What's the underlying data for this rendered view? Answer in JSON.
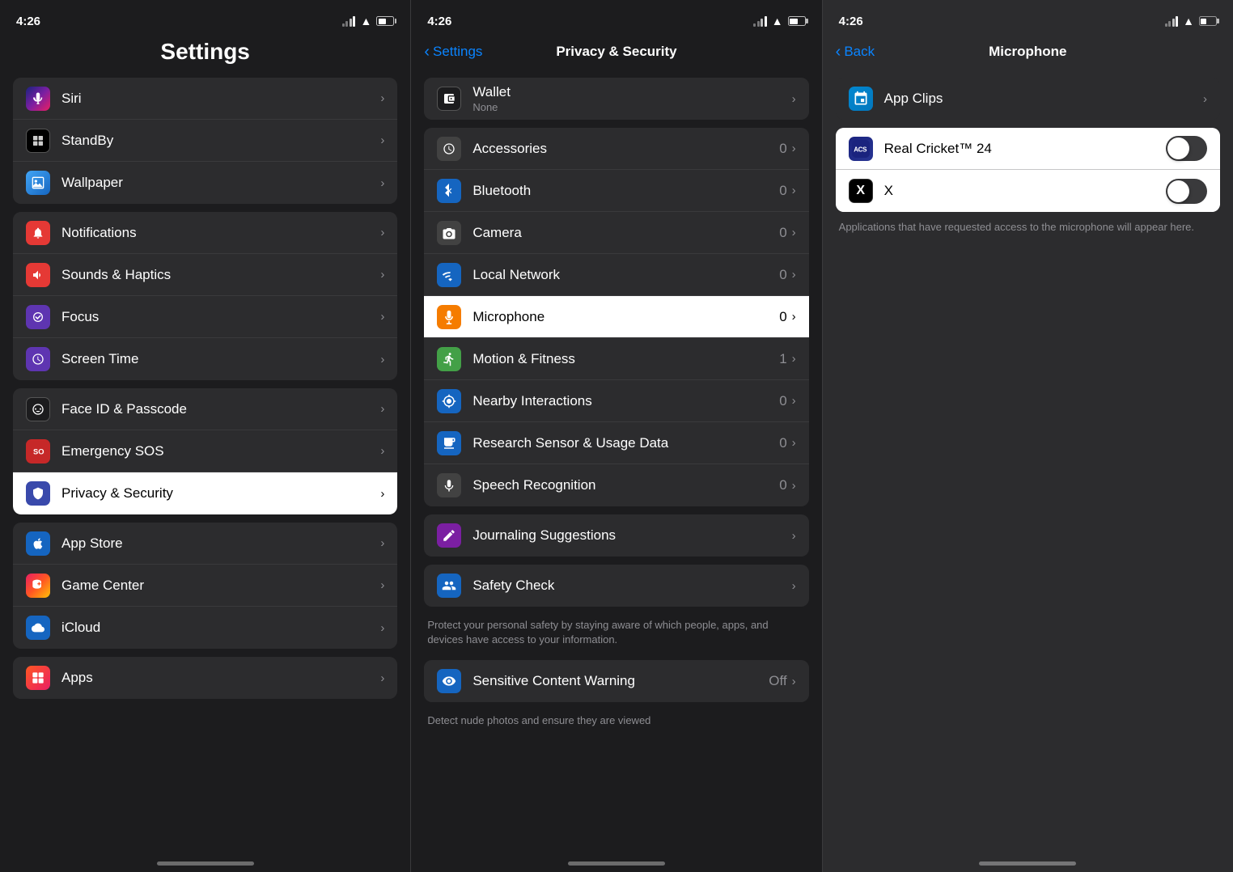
{
  "panels": {
    "left": {
      "time": "4:26",
      "title": "Settings",
      "items_group1": [
        {
          "label": "Siri",
          "icon": "siri",
          "emoji": "🎙"
        },
        {
          "label": "StandBy",
          "icon": "standby",
          "emoji": "⏱"
        },
        {
          "label": "Wallpaper",
          "icon": "wallpaper",
          "emoji": "🌅"
        }
      ],
      "items_group2": [
        {
          "label": "Notifications",
          "icon": "notifications",
          "emoji": "🔔"
        },
        {
          "label": "Sounds & Haptics",
          "icon": "sounds",
          "emoji": "🔊"
        },
        {
          "label": "Focus",
          "icon": "focus",
          "emoji": "🌙"
        },
        {
          "label": "Screen Time",
          "icon": "screentime",
          "emoji": "⏰"
        }
      ],
      "items_group3": [
        {
          "label": "Face ID & Passcode",
          "icon": "faceid",
          "emoji": "👤"
        },
        {
          "label": "Emergency SOS",
          "icon": "emergency",
          "emoji": "🆘"
        },
        {
          "label": "Privacy & Security",
          "icon": "privacy",
          "emoji": "✋",
          "highlighted": true
        }
      ],
      "items_group4": [
        {
          "label": "App Store",
          "icon": "appstore",
          "emoji": "🅐"
        },
        {
          "label": "Game Center",
          "icon": "gamecenter",
          "emoji": "🎮"
        },
        {
          "label": "iCloud",
          "icon": "icloud",
          "emoji": "☁️"
        }
      ],
      "items_group5": [
        {
          "label": "Apps",
          "icon": "apps",
          "emoji": "📱"
        }
      ]
    },
    "mid": {
      "time": "4:26",
      "back_label": "Settings",
      "title": "Privacy & Security",
      "items_group1": [
        {
          "label": "Wallet",
          "sublabel": "None",
          "icon": "wallet",
          "emoji": "💳",
          "value": ""
        }
      ],
      "items_group2": [
        {
          "label": "Accessories",
          "icon": "accessories",
          "emoji": "⚙️",
          "value": "0"
        },
        {
          "label": "Bluetooth",
          "icon": "bluetooth",
          "emoji": "Ⓑ",
          "value": "0"
        },
        {
          "label": "Camera",
          "icon": "camera",
          "emoji": "📷",
          "value": "0"
        },
        {
          "label": "Local Network",
          "icon": "localnetwork",
          "emoji": "🌐",
          "value": "0"
        },
        {
          "label": "Microphone",
          "icon": "microphone",
          "emoji": "🎤",
          "value": "0",
          "highlighted": true
        },
        {
          "label": "Motion & Fitness",
          "icon": "motion",
          "emoji": "🏃",
          "value": "1"
        },
        {
          "label": "Nearby Interactions",
          "icon": "nearby",
          "emoji": "📡",
          "value": "0"
        },
        {
          "label": "Research Sensor & Usage Data",
          "icon": "research",
          "emoji": "📊",
          "value": "0"
        },
        {
          "label": "Speech Recognition",
          "icon": "speech",
          "emoji": "🎙",
          "value": "0"
        }
      ],
      "items_group3": [
        {
          "label": "Journaling Suggestions",
          "icon": "journaling",
          "emoji": "✍️"
        }
      ],
      "items_group4": [
        {
          "label": "Safety Check",
          "icon": "safety",
          "emoji": "👥"
        }
      ],
      "safety_desc": "Protect your personal safety by staying aware of which people, apps, and devices have access to your information.",
      "items_group5": [
        {
          "label": "Sensitive Content Warning",
          "icon": "sensitive",
          "emoji": "👁",
          "value": "Off"
        }
      ],
      "sensitive_desc": "Detect nude photos and ensure they are viewed"
    },
    "right": {
      "time": "4:26",
      "back_label": "Back",
      "title": "Microphone",
      "app_clips": {
        "label": "App Clips",
        "icon": "appclip",
        "emoji": "✂️"
      },
      "apps": [
        {
          "label": "Real Cricket™ 24",
          "icon": "cricket",
          "toggle": false
        },
        {
          "label": "X",
          "icon": "x",
          "toggle": false
        }
      ],
      "helper_text": "Applications that have requested access to the microphone will appear here."
    }
  }
}
